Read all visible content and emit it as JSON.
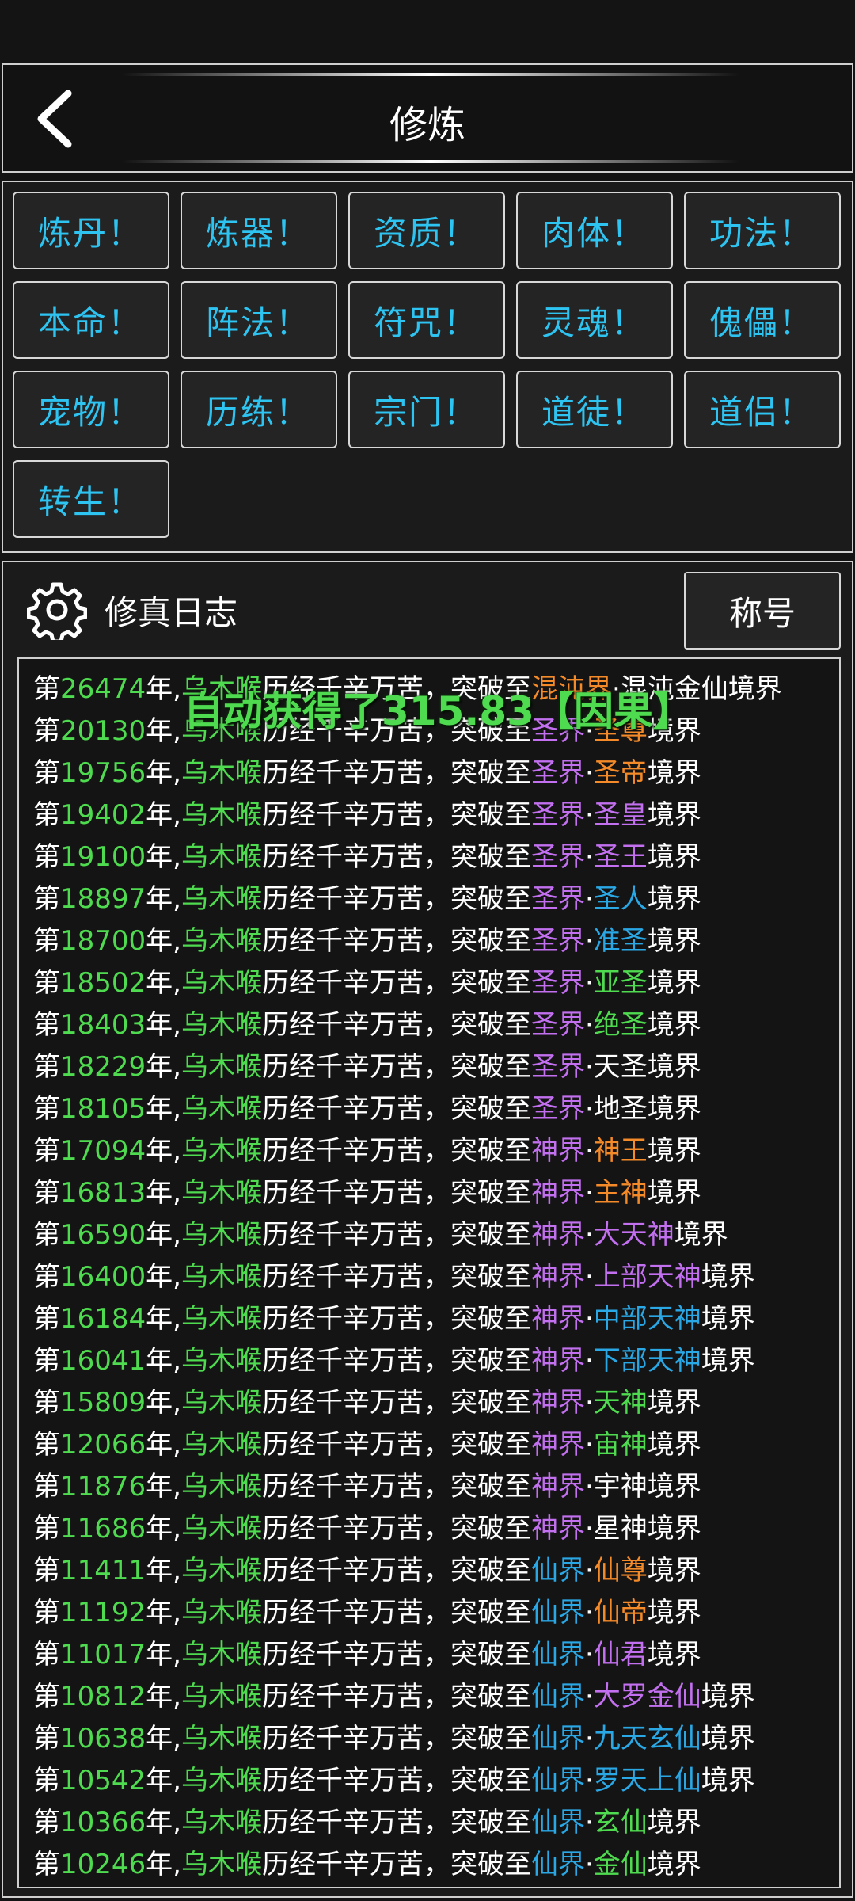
{
  "header": {
    "title": "修炼"
  },
  "grid": {
    "buttons": [
      "炼丹！",
      "炼器！",
      "资质！",
      "肉体！",
      "功法！",
      "本命！",
      "阵法！",
      "符咒！",
      "灵魂！",
      "傀儡！",
      "宠物！",
      "历练！",
      "宗门！",
      "道徒！",
      "道侣！",
      "转生！"
    ]
  },
  "log": {
    "title": "修真日志",
    "title_button": "称号",
    "year_prefix": "第",
    "year_suffix": "年,",
    "name": "乌木喉",
    "middle": "历经千辛万苦，突破至",
    "dot": "·",
    "suffix": "境界",
    "entries": [
      {
        "year": "26474",
        "realm": "混沌界",
        "realm_color": "orange",
        "rank": "混沌金仙",
        "rank_color": "white"
      },
      {
        "year": "20130",
        "realm": "圣界",
        "realm_color": "purple",
        "rank": "圣尊",
        "rank_color": "orange"
      },
      {
        "year": "19756",
        "realm": "圣界",
        "realm_color": "purple",
        "rank": "圣帝",
        "rank_color": "orange"
      },
      {
        "year": "19402",
        "realm": "圣界",
        "realm_color": "purple",
        "rank": "圣皇",
        "rank_color": "purple"
      },
      {
        "year": "19100",
        "realm": "圣界",
        "realm_color": "purple",
        "rank": "圣王",
        "rank_color": "purple"
      },
      {
        "year": "18897",
        "realm": "圣界",
        "realm_color": "purple",
        "rank": "圣人",
        "rank_color": "blue"
      },
      {
        "year": "18700",
        "realm": "圣界",
        "realm_color": "purple",
        "rank": "准圣",
        "rank_color": "blue"
      },
      {
        "year": "18502",
        "realm": "圣界",
        "realm_color": "purple",
        "rank": "亚圣",
        "rank_color": "green"
      },
      {
        "year": "18403",
        "realm": "圣界",
        "realm_color": "purple",
        "rank": "绝圣",
        "rank_color": "green"
      },
      {
        "year": "18229",
        "realm": "圣界",
        "realm_color": "purple",
        "rank": "天圣",
        "rank_color": "white"
      },
      {
        "year": "18105",
        "realm": "圣界",
        "realm_color": "purple",
        "rank": "地圣",
        "rank_color": "white"
      },
      {
        "year": "17094",
        "realm": "神界",
        "realm_color": "purple",
        "rank": "神王",
        "rank_color": "orange"
      },
      {
        "year": "16813",
        "realm": "神界",
        "realm_color": "purple",
        "rank": "主神",
        "rank_color": "orange"
      },
      {
        "year": "16590",
        "realm": "神界",
        "realm_color": "purple",
        "rank": "大天神",
        "rank_color": "purple"
      },
      {
        "year": "16400",
        "realm": "神界",
        "realm_color": "purple",
        "rank": "上部天神",
        "rank_color": "purple"
      },
      {
        "year": "16184",
        "realm": "神界",
        "realm_color": "purple",
        "rank": "中部天神",
        "rank_color": "blue"
      },
      {
        "year": "16041",
        "realm": "神界",
        "realm_color": "purple",
        "rank": "下部天神",
        "rank_color": "blue"
      },
      {
        "year": "15809",
        "realm": "神界",
        "realm_color": "purple",
        "rank": "天神",
        "rank_color": "green"
      },
      {
        "year": "12066",
        "realm": "神界",
        "realm_color": "purple",
        "rank": "宙神",
        "rank_color": "green"
      },
      {
        "year": "11876",
        "realm": "神界",
        "realm_color": "purple",
        "rank": "宇神",
        "rank_color": "white"
      },
      {
        "year": "11686",
        "realm": "神界",
        "realm_color": "purple",
        "rank": "星神",
        "rank_color": "white"
      },
      {
        "year": "11411",
        "realm": "仙界",
        "realm_color": "blue",
        "rank": "仙尊",
        "rank_color": "orange"
      },
      {
        "year": "11192",
        "realm": "仙界",
        "realm_color": "blue",
        "rank": "仙帝",
        "rank_color": "orange"
      },
      {
        "year": "11017",
        "realm": "仙界",
        "realm_color": "blue",
        "rank": "仙君",
        "rank_color": "purple"
      },
      {
        "year": "10812",
        "realm": "仙界",
        "realm_color": "blue",
        "rank": "大罗金仙",
        "rank_color": "purple"
      },
      {
        "year": "10638",
        "realm": "仙界",
        "realm_color": "blue",
        "rank": "九天玄仙",
        "rank_color": "blue"
      },
      {
        "year": "10542",
        "realm": "仙界",
        "realm_color": "blue",
        "rank": "罗天上仙",
        "rank_color": "blue"
      },
      {
        "year": "10366",
        "realm": "仙界",
        "realm_color": "blue",
        "rank": "玄仙",
        "rank_color": "green"
      },
      {
        "year": "10246",
        "realm": "仙界",
        "realm_color": "blue",
        "rank": "金仙",
        "rank_color": "green"
      }
    ]
  },
  "toast": {
    "text": "自动获得了315.83【因果】"
  },
  "colors": {
    "accent_cyan": "#2ec4f2",
    "green": "#4fdb4f",
    "orange": "#f58a29",
    "purple": "#c370f0",
    "blue": "#2aa8e6",
    "background": "#141414"
  },
  "icons": {
    "back": "chevron-left-icon",
    "settings": "gear-icon"
  }
}
